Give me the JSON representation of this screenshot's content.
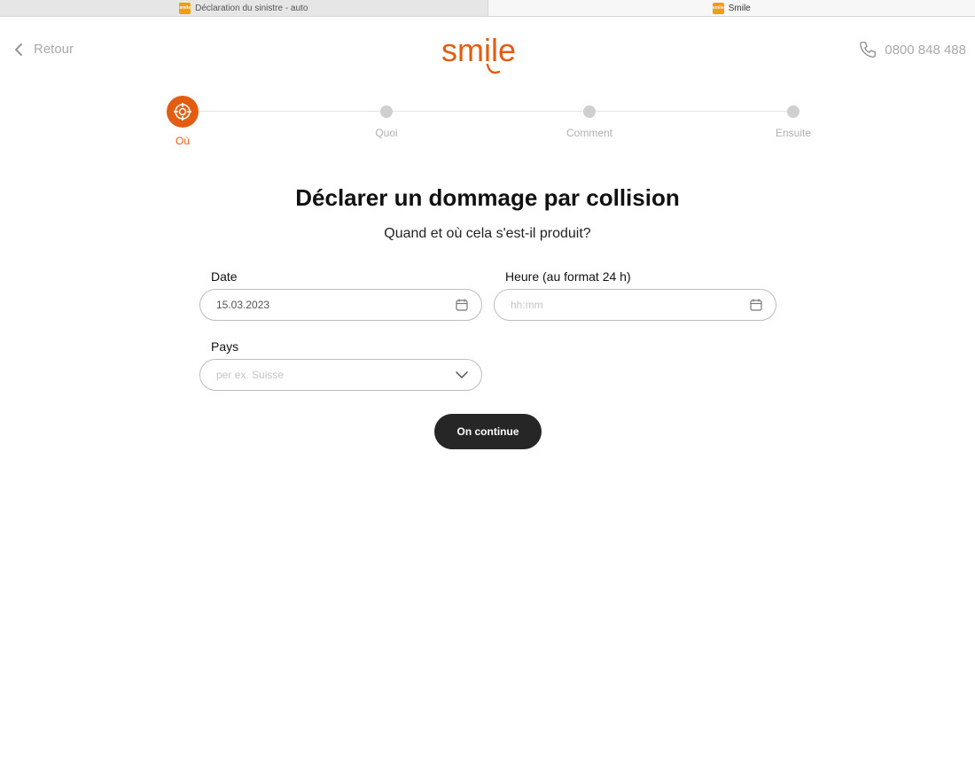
{
  "browser": {
    "tabs": [
      {
        "title": "Déclaration du sinistre - auto",
        "active": false
      },
      {
        "title": "Smile",
        "active": true
      }
    ]
  },
  "header": {
    "back_label": "Retour",
    "logo_text": "smile",
    "phone_number": "0800 848 488",
    "brand_color": "#e25d12"
  },
  "stepper": {
    "steps": [
      {
        "label": "Où",
        "active": true
      },
      {
        "label": "Quoi",
        "active": false
      },
      {
        "label": "Comment",
        "active": false
      },
      {
        "label": "Ensuite",
        "active": false
      }
    ]
  },
  "page": {
    "title": "Déclarer un dommage par collision",
    "subtitle": "Quand et où cela s'est-il produit?"
  },
  "form": {
    "date": {
      "label": "Date",
      "value": "15.03.2023"
    },
    "time": {
      "label": "Heure (au format 24 h)",
      "placeholder": "hh:mm"
    },
    "country": {
      "label": "Pays",
      "placeholder": "per ex. Suisse"
    },
    "submit_label": "On continue"
  }
}
